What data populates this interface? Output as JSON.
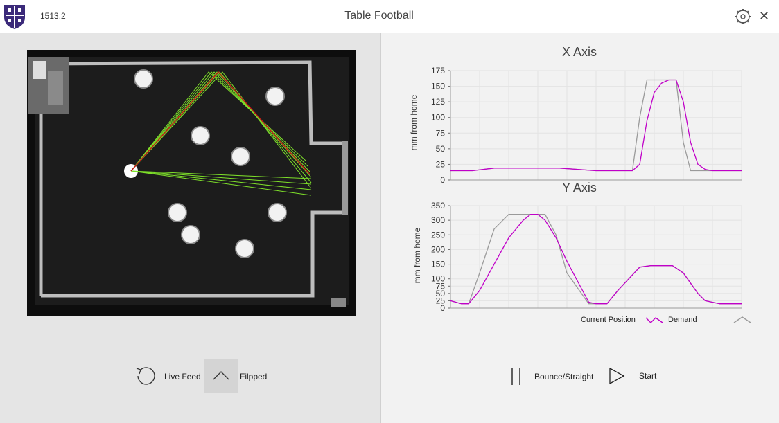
{
  "titlebar": {
    "version": "1513.2",
    "title": "Table Football",
    "logo_icon": "shield-crest-icon",
    "settings_icon": "gear-icon",
    "close_glyph": "✕"
  },
  "controls": {
    "live_feed_label": "Live Feed",
    "flipped_label": "Filpped",
    "bounce_label": "Bounce/Straight",
    "start_label": "Start"
  },
  "legend": {
    "current_label": "Current Position",
    "demand_label": "Demand",
    "current_color": "#c000c8",
    "demand_color": "#9a9a9a"
  },
  "chart_data": [
    {
      "type": "line",
      "title": "X Axis",
      "ylabel": "mm from home",
      "ylim": [
        0,
        175
      ],
      "yticks": [
        0,
        25,
        50,
        75,
        100,
        125,
        150,
        175
      ],
      "x": [
        0,
        30,
        60,
        100,
        150,
        200,
        230,
        240,
        250,
        260,
        270,
        280,
        290,
        300,
        305,
        310,
        320,
        330,
        340,
        350,
        360,
        400
      ],
      "series": [
        {
          "name": "Current Position",
          "color": "#c000c8",
          "values": [
            15,
            15,
            19,
            19,
            19,
            15,
            15,
            15,
            15,
            25,
            95,
            140,
            155,
            160,
            160,
            160,
            125,
            60,
            25,
            17,
            15,
            15
          ]
        },
        {
          "name": "Demand",
          "color": "#9a9a9a",
          "values": [
            15,
            15,
            19,
            19,
            19,
            15,
            15,
            15,
            15,
            100,
            160,
            160,
            160,
            160,
            160,
            160,
            60,
            15,
            15,
            15,
            15,
            15
          ]
        }
      ]
    },
    {
      "type": "line",
      "title": "Y Axis",
      "ylabel": "mm from home",
      "ylim": [
        0,
        350
      ],
      "yticks": [
        0,
        25,
        50,
        75,
        100,
        150,
        200,
        250,
        300,
        350
      ],
      "x": [
        0,
        15,
        25,
        40,
        60,
        80,
        100,
        110,
        120,
        130,
        145,
        160,
        190,
        200,
        215,
        230,
        260,
        275,
        290,
        305,
        320,
        330,
        340,
        350,
        370,
        390,
        400
      ],
      "series": [
        {
          "name": "Current Position",
          "color": "#c000c8",
          "values": [
            25,
            15,
            15,
            60,
            150,
            240,
            300,
            320,
            320,
            300,
            240,
            160,
            20,
            15,
            15,
            60,
            140,
            145,
            145,
            145,
            120,
            85,
            50,
            25,
            15,
            15,
            15
          ]
        },
        {
          "name": "Demand",
          "color": "#9a9a9a",
          "values": [
            25,
            15,
            15,
            120,
            270,
            320,
            320,
            320,
            320,
            320,
            250,
            120,
            15,
            15,
            15,
            60,
            140,
            145,
            145,
            145,
            120,
            85,
            50,
            25,
            15,
            15,
            15
          ]
        }
      ]
    }
  ]
}
